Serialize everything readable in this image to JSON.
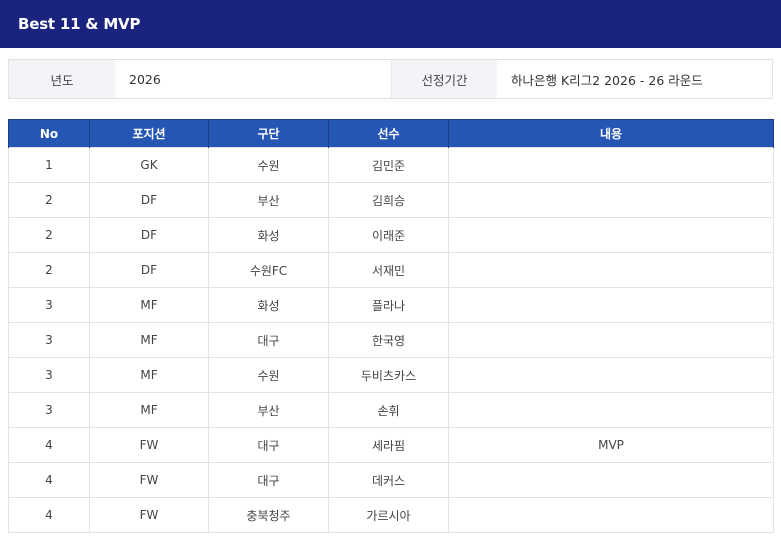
{
  "header": {
    "title": "Best 11 & MVP"
  },
  "info": {
    "year_label": "년도",
    "year_value": "2026",
    "period_label": "선정기간",
    "period_value": "하나은행 K리그2 2026 - 26 라운드"
  },
  "table": {
    "columns": [
      "No",
      "포지션",
      "구단",
      "선수",
      "내용"
    ],
    "rows": [
      {
        "no": "1",
        "position": "GK",
        "club": "수원",
        "player": "김민준",
        "note": ""
      },
      {
        "no": "2",
        "position": "DF",
        "club": "부산",
        "player": "김희승",
        "note": ""
      },
      {
        "no": "2",
        "position": "DF",
        "club": "화성",
        "player": "이래준",
        "note": ""
      },
      {
        "no": "2",
        "position": "DF",
        "club": "수원FC",
        "player": "서재민",
        "note": ""
      },
      {
        "no": "3",
        "position": "MF",
        "club": "화성",
        "player": "플라나",
        "note": ""
      },
      {
        "no": "3",
        "position": "MF",
        "club": "대구",
        "player": "한국영",
        "note": ""
      },
      {
        "no": "3",
        "position": "MF",
        "club": "수원",
        "player": "두비츠카스",
        "note": ""
      },
      {
        "no": "3",
        "position": "MF",
        "club": "부산",
        "player": "손휘",
        "note": ""
      },
      {
        "no": "4",
        "position": "FW",
        "club": "대구",
        "player": "세라핌",
        "note": "MVP"
      },
      {
        "no": "4",
        "position": "FW",
        "club": "대구",
        "player": "데커스",
        "note": ""
      },
      {
        "no": "4",
        "position": "FW",
        "club": "충북청주",
        "player": "가르시아",
        "note": ""
      }
    ]
  }
}
